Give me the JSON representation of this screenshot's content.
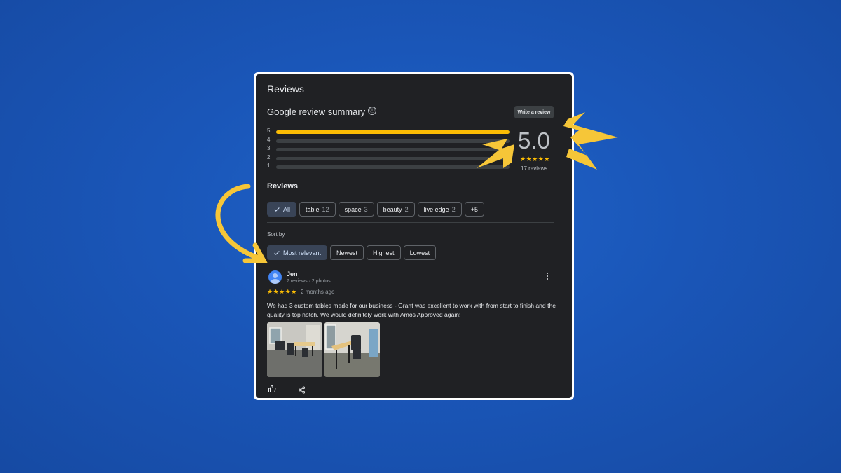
{
  "panel": {
    "title": "Reviews",
    "summary_title": "Google review summary",
    "info_icon": "ⓘ",
    "write_review_label": "Write a review"
  },
  "rating_summary": {
    "average": "5.0",
    "stars": "★★★★★",
    "review_count": "17 reviews",
    "distribution": [
      {
        "label": "5",
        "fraction": 1.0
      },
      {
        "label": "4",
        "fraction": 0
      },
      {
        "label": "3",
        "fraction": 0
      },
      {
        "label": "2",
        "fraction": 0
      },
      {
        "label": "1",
        "fraction": 0
      }
    ]
  },
  "reviews_section": {
    "title": "Reviews",
    "filter_chips": [
      {
        "label": "All",
        "count": "",
        "selected": true
      },
      {
        "label": "table",
        "count": "12",
        "selected": false
      },
      {
        "label": "space",
        "count": "3",
        "selected": false
      },
      {
        "label": "beauty",
        "count": "2",
        "selected": false
      },
      {
        "label": "live edge",
        "count": "2",
        "selected": false
      },
      {
        "label": "+5",
        "count": "",
        "selected": false
      }
    ],
    "sort_label": "Sort by",
    "sort_chips": [
      {
        "label": "Most relevant",
        "selected": true
      },
      {
        "label": "Newest",
        "selected": false
      },
      {
        "label": "Highest",
        "selected": false
      },
      {
        "label": "Lowest",
        "selected": false
      }
    ]
  },
  "review": {
    "author": "Jen",
    "meta": "7 reviews · 2 photos",
    "stars": "★★★★★",
    "time": "2 months ago",
    "text": "We had 3 custom tables made for our business - Grant was excellent to work with from start to finish and the quality is top notch. We would definitely work with Amos Approved again!",
    "photos": [
      "office-photo-1",
      "office-photo-2"
    ]
  },
  "icons": {
    "check": "check-icon",
    "more": "more-vert-icon",
    "like": "thumb-up-icon",
    "share": "share-icon"
  },
  "colors": {
    "background": "#1a56b8",
    "panel": "#202124",
    "star": "#fbbc04",
    "selected_chip": "#394457",
    "annotation": "#f6c638"
  }
}
